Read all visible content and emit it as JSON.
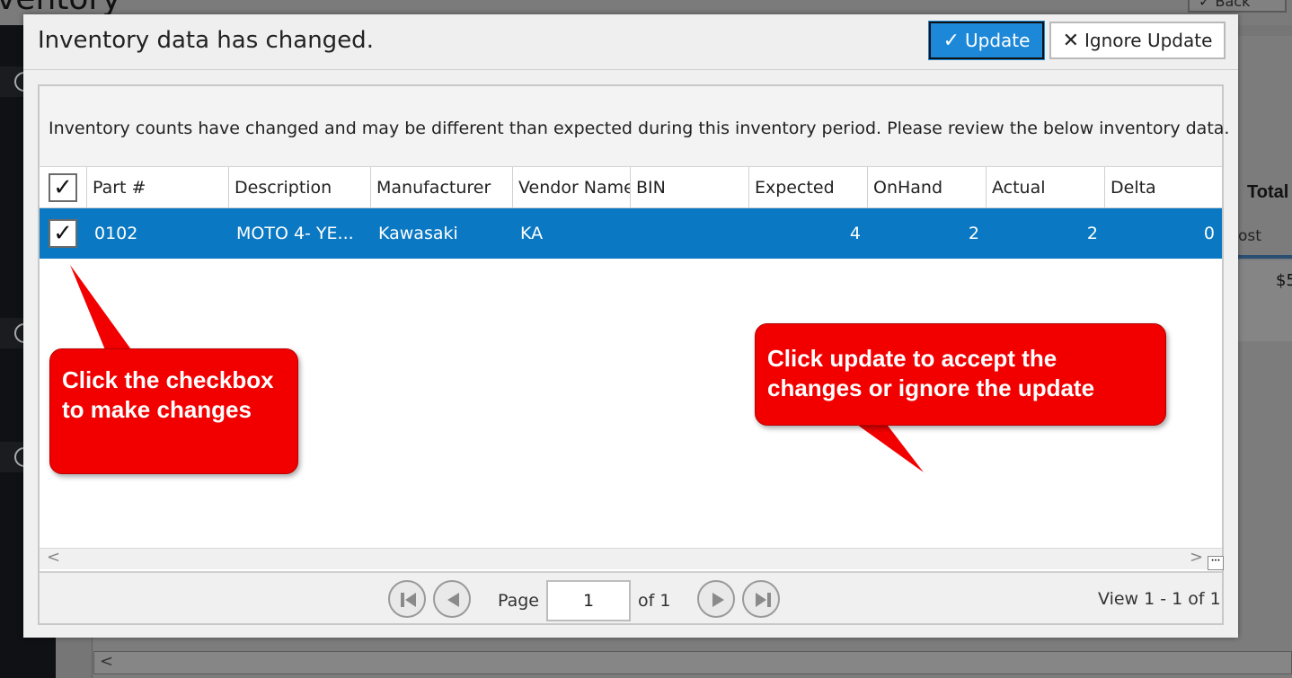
{
  "background": {
    "page_title": "ventory",
    "back_button": "✓ Back",
    "total_label": "Total",
    "row_text": "ost",
    "money_text": "$5",
    "scroll_left": "<"
  },
  "dialog": {
    "title": "Inventory data has changed.",
    "update_label": "Update",
    "ignore_label": "Ignore Update",
    "notice": "Inventory counts have changed and may be different than expected during this inventory period. Please review the below inventory data."
  },
  "grid": {
    "columns": [
      "Part #",
      "Description",
      "Manufacturer",
      "Vendor Name",
      "BIN",
      "Expected",
      "OnHand",
      "Actual",
      "Delta"
    ],
    "rows": [
      {
        "checked": true,
        "part": "0102",
        "description": "MOTO 4- YE...",
        "manufacturer": "Kawasaki",
        "vendor": "KA",
        "bin": "",
        "expected": "4",
        "onhand": "2",
        "actual": "2",
        "delta": "0"
      }
    ]
  },
  "pager": {
    "page_label": "Page",
    "page_value": "1",
    "of_label": "of 1",
    "view_label": "View 1 - 1 of 1"
  },
  "callouts": {
    "checkbox_tip": "Click the checkbox to make changes",
    "update_tip": "Click update to accept the changes or ignore the update"
  },
  "colors": {
    "accent": "#1e88d8",
    "selected_row": "#0a78c2",
    "callout": "#f20000"
  }
}
